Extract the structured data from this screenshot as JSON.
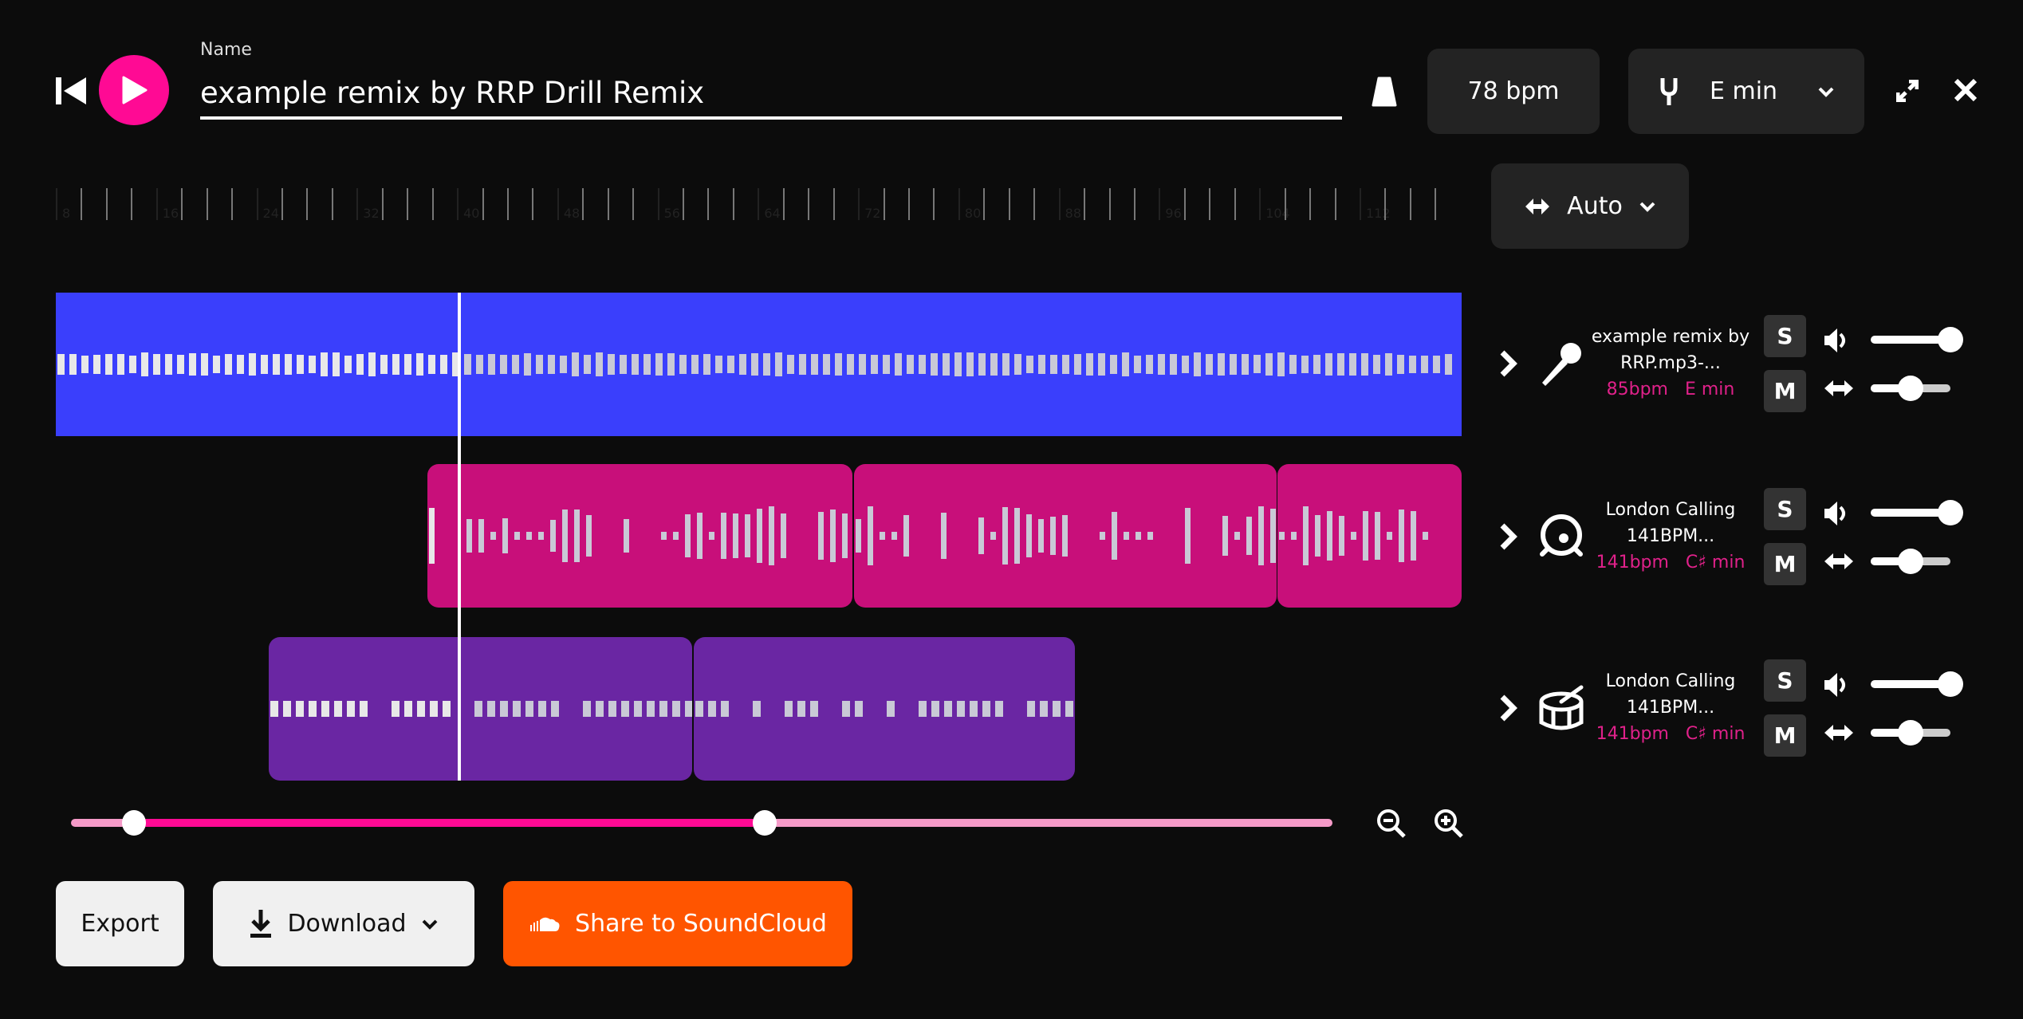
{
  "header": {
    "name_label": "Name",
    "name_value": "example remix by RRP Drill Remix",
    "bpm": "78 bpm",
    "key": "E min",
    "icons": [
      "skip-back-icon",
      "play-icon",
      "metronome-icon",
      "tuning-fork-icon",
      "chevron-down-icon",
      "expand-icon",
      "close-icon"
    ]
  },
  "ruler": {
    "labels": [
      "8",
      "16",
      "24",
      "32",
      "40",
      "48",
      "56",
      "64",
      "72",
      "80",
      "88",
      "96",
      "104",
      "112"
    ]
  },
  "stretch": {
    "mode": "Auto"
  },
  "tracks": [
    {
      "name": "example remix by RRP.mp3-...",
      "bpm": "85bpm",
      "key": "E min",
      "icon": "microphone-icon",
      "color": "#3a3ffc",
      "volume": 1.0,
      "pan": 0.5
    },
    {
      "name": "London Calling 141BPM...",
      "bpm": "141bpm",
      "key": "C♯ min",
      "icon": "kick-drum-icon",
      "color": "#c80f7a",
      "volume": 1.0,
      "pan": 0.5
    },
    {
      "name": "London Calling 141BPM...",
      "bpm": "141bpm",
      "key": "C♯ min",
      "icon": "snare-drum-icon",
      "color": "#6a26a3",
      "volume": 1.0,
      "pan": 0.5
    }
  ],
  "solo_label": "S",
  "mute_label": "M",
  "scroll": {
    "start": 0.05,
    "end": 0.55
  },
  "footer": {
    "export": "Export",
    "download": "Download",
    "share": "Share to SoundCloud"
  },
  "colors": {
    "accent": "#ff0a94",
    "soundcloud": "#ff5500",
    "track_bg": "#232323"
  }
}
